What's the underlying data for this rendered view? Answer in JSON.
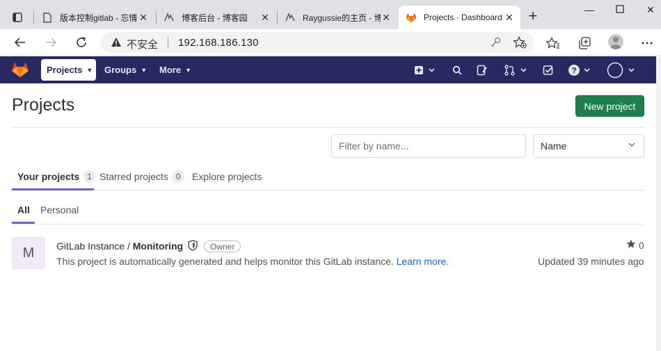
{
  "browser": {
    "tabs": [
      {
        "title": "版本控制gitlab - 忘情",
        "icon": "page-icon"
      },
      {
        "title": "博客后台 - 博客园",
        "icon": "cnblogs-icon"
      },
      {
        "title": "Raygussie的主页 - 博",
        "icon": "cnblogs-icon"
      },
      {
        "title": "Projects · Dashboard",
        "icon": "gitlab-icon"
      }
    ],
    "security_label": "不安全",
    "url": "192.168.186.130"
  },
  "navbar": {
    "projects": "Projects",
    "groups": "Groups",
    "more": "More"
  },
  "page": {
    "title": "Projects",
    "new_project": "New project",
    "filter_placeholder": "Filter by name...",
    "sort_value": "Name",
    "tabs": [
      {
        "label": "Your projects",
        "count": "1"
      },
      {
        "label": "Starred projects",
        "count": "0"
      },
      {
        "label": "Explore projects"
      }
    ],
    "subtabs": [
      {
        "label": "All"
      },
      {
        "label": "Personal"
      }
    ]
  },
  "projects": [
    {
      "avatar_letter": "M",
      "namespace": "GitLab Instance /",
      "name": "Monitoring",
      "role": "Owner",
      "description": "This project is automatically generated and helps monitor this GitLab instance.",
      "learn_more": "Learn more.",
      "stars": "0",
      "updated": "Updated 39 minutes ago"
    }
  ],
  "colors": {
    "navbar": "#292961",
    "primary_button": "#1f7f4a",
    "tab_underline": "#6666c4",
    "link": "#1068bf"
  }
}
